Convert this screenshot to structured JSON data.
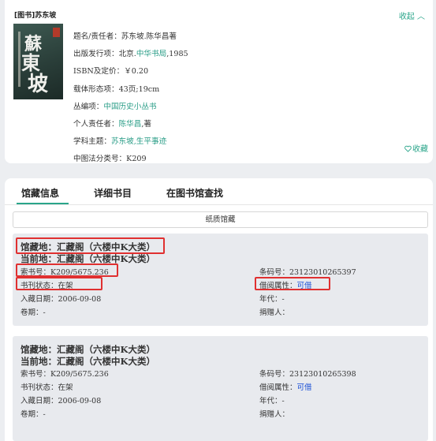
{
  "record": {
    "type_title": "[图书]苏东坡",
    "collapse_label": "收起 ︿",
    "collect_label": "收藏",
    "cover": {
      "chars": [
        "蘇",
        "東",
        "坡"
      ]
    },
    "fields": [
      {
        "label": "题名/责任者：",
        "value": "苏东坡.陈华昌著"
      },
      {
        "label": "出版发行项：",
        "value_prefix": "北京.",
        "link": "中华书局",
        "value_suffix": ",1985"
      },
      {
        "label": "ISBN及定价：",
        "value": "￥0.20"
      },
      {
        "label": "载体形态项：",
        "value": "43页;19cm"
      },
      {
        "label": "丛编项：",
        "link": "中国历史小丛书"
      },
      {
        "label": "个人责任者：",
        "link": "陈华昌",
        "value_suffix": ",著"
      },
      {
        "label": "学科主题：",
        "link": "苏东坡,生平事迹"
      },
      {
        "label": "中图法分类号：",
        "value": "K209"
      }
    ]
  },
  "tabs": [
    "馆藏信息",
    "详细书目",
    "在图书馆查找"
  ],
  "paper_button": "纸质馆藏",
  "holdings": [
    {
      "location_line1": "馆藏地：汇藏阁（六楼中K大类）",
      "location_line2": "当前地：汇藏阁（六楼中K大类）",
      "call_no": "索书号：K209/5675.236",
      "status": "书刊状态：在架",
      "date": "入藏日期：2006-09-08",
      "volume": "卷期：-",
      "barcode": "条码号：23123010265397",
      "loan_label": "借阅属性：",
      "loan_value": "可借",
      "year": "年代：-",
      "donor": "捐赠人："
    },
    {
      "location_line1": "馆藏地：汇藏阁（六楼中K大类）",
      "location_line2": "当前地：汇藏阁（六楼中K大类）",
      "call_no": "索书号：K209/5675.236",
      "status": "书刊状态：在架",
      "date": "入藏日期：2006-09-08",
      "volume": "卷期：-",
      "barcode": "条码号：23123010265398",
      "loan_label": "借阅属性：",
      "loan_value": "可借",
      "year": "年代：-",
      "donor": "捐赠人："
    }
  ],
  "colors": {
    "accent": "#2aa58a",
    "link_blue": "#1a4fd6",
    "highlight": "#e03030"
  }
}
